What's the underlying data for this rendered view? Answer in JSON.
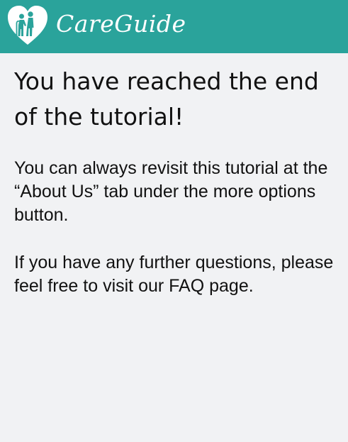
{
  "header": {
    "brand": "CareGuide",
    "logo_icon": "heart-with-caregiver-icon",
    "background_color": "#2aa39b"
  },
  "content": {
    "title": "You have reached the end of the tutorial!",
    "paragraph_1": "You can always revisit this tutorial at the “About Us” tab under the more options button.",
    "paragraph_2": "If you have any further questions, please feel free to visit our FAQ page."
  }
}
